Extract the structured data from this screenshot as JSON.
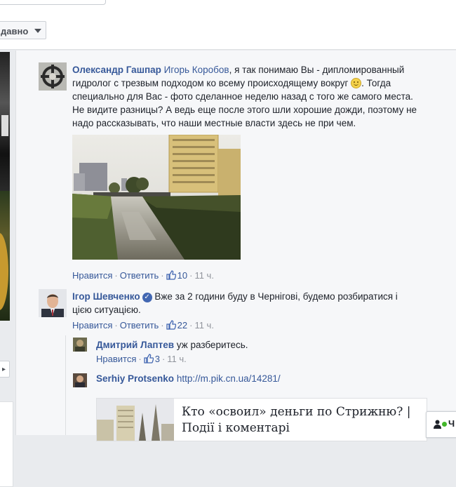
{
  "sort_button": {
    "label": "давно"
  },
  "comments": [
    {
      "author": "Олександр Гашпар",
      "mention": "Игорь Коробов",
      "lines": [
        ", я так понимаю Вы - дипломированный",
        "гидролог с трезвым подходом ко всему происходящему вокруг",
        ". Тогда",
        "специально для Вас - фото сделанное неделю назад с того же самого места.",
        "Не видите разницы? А ведь еще после этого шли хорошие дожди, поэтому не",
        "надо рассказывать, что наши местные власти здесь не при чем."
      ],
      "like": "Нравится",
      "reply": "Ответить",
      "likes": "10",
      "time": "11 ч."
    },
    {
      "author": "Ігор Шевченко",
      "lines": [
        "Вже за 2 години буду в Чернігові, будемо розбиратися і",
        "цією ситуацією."
      ],
      "like": "Нравится",
      "reply": "Ответить",
      "likes": "22",
      "time": "11 ч."
    }
  ],
  "replies": [
    {
      "author": "Дмитрий Лаптев",
      "text": "уж разберитесь.",
      "like": "Нравится",
      "likes": "3",
      "time": "11 ч."
    },
    {
      "author": "Serhiy Protsenko",
      "link": "http://m.pik.cn.ua/14281/"
    }
  ],
  "link_preview": {
    "title": "Кто «освоил» деньги по Стрижню? | Події і коментарі"
  },
  "chat": {
    "label": "Ч"
  },
  "colors": {
    "link": "#365899",
    "meta": "#90949c",
    "panel": "#f6f7f9"
  }
}
